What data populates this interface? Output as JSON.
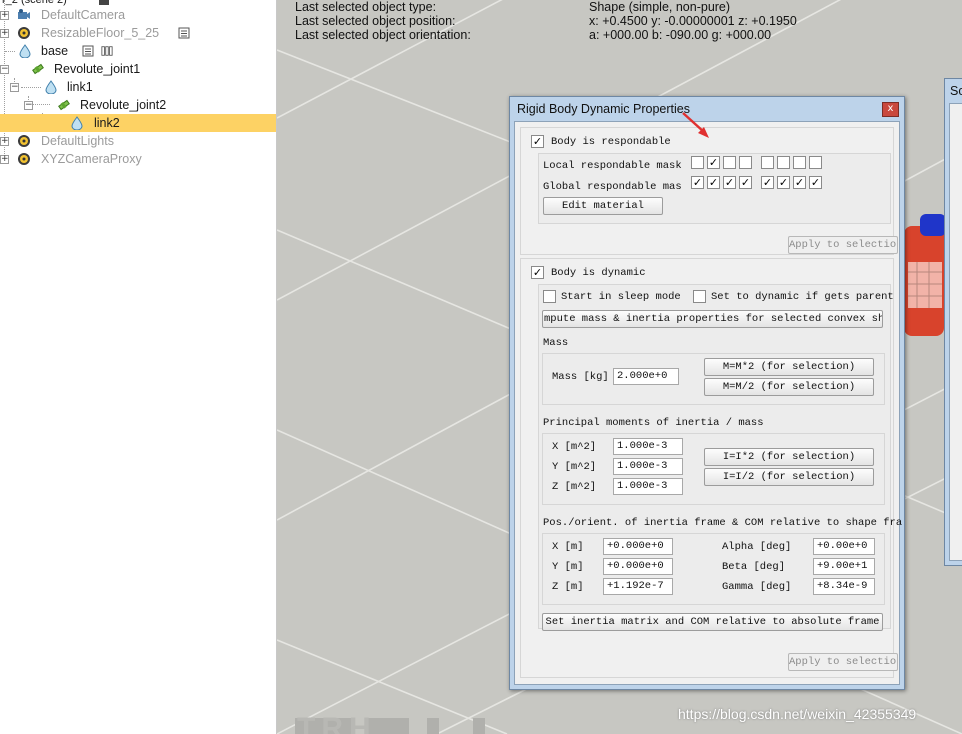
{
  "tree": {
    "items": [
      {
        "label": "r_2 (scene 2)",
        "dim": false
      },
      {
        "label": "DefaultCamera",
        "dim": true
      },
      {
        "label": "ResizableFloor_5_25",
        "dim": true
      },
      {
        "label": "base",
        "dim": false
      },
      {
        "label": "Revolute_joint1",
        "dim": false
      },
      {
        "label": "link1",
        "dim": false
      },
      {
        "label": "Revolute_joint2",
        "dim": false
      },
      {
        "label": "link2",
        "dim": false,
        "selected": true
      },
      {
        "label": "DefaultLights",
        "dim": true
      },
      {
        "label": "XYZCameraProxy",
        "dim": true
      }
    ]
  },
  "viewport": {
    "info": [
      {
        "label": "Last selected object type:",
        "value": "Shape (simple, non-pure)"
      },
      {
        "label": "Last selected object position:",
        "value": "x: +0.4500    y: -0.00000001    z: +0.1950"
      },
      {
        "label": "Last selected object orientation:",
        "value": "a: +000.00    b: -090.00    g: +000.00"
      }
    ],
    "watermark": "https://blog.csdn.net/weixin_42355349",
    "bottom_text": "TRH"
  },
  "dialog": {
    "title": "Rigid Body Dynamic Properties",
    "close_glyph": "x",
    "body_respondable": {
      "label": "Body is respondable",
      "checked": true
    },
    "local_mask": {
      "label": "Local respondable mask",
      "bits": [
        false,
        true,
        false,
        false,
        false,
        false,
        false,
        false
      ]
    },
    "global_mask": {
      "label": "Global respondable mas",
      "bits": [
        true,
        true,
        true,
        true,
        true,
        true,
        true,
        true
      ]
    },
    "edit_material": "Edit material",
    "apply_top": "Apply to selection",
    "body_dynamic": {
      "label": "Body is dynamic",
      "checked": true
    },
    "sleep_mode": {
      "label": "Start in sleep mode",
      "checked": false
    },
    "set_dynamic": {
      "label": "Set to dynamic if gets parent",
      "checked": false
    },
    "compute_btn": "mpute mass & inertia properties for selected convex shap",
    "mass_title": "Mass",
    "mass_label": "Mass [kg]",
    "mass_value": "2.000e+0",
    "mass_x2": "M=M*2  (for selection)",
    "mass_half": "M=M/2  (for selection)",
    "inertia_title": "Principal moments of inertia / mass",
    "inertia": [
      {
        "label": "X [m^2]",
        "value": "1.000e-3"
      },
      {
        "label": "Y [m^2]",
        "value": "1.000e-3"
      },
      {
        "label": "Z [m^2]",
        "value": "1.000e-3"
      }
    ],
    "inertia_x2": "I=I*2  (for selection)",
    "inertia_half": "I=I/2  (for selection)",
    "frame_title": "Pos./orient. of inertia frame & COM relative to shape fra",
    "pos": [
      {
        "label": "X [m]",
        "value": "+0.000e+0"
      },
      {
        "label": "Y [m]",
        "value": "+0.000e+0"
      },
      {
        "label": "Z [m]",
        "value": "+1.192e-7"
      }
    ],
    "orient": [
      {
        "label": "Alpha [deg]",
        "value": "+0.00e+0"
      },
      {
        "label": "Beta [deg]",
        "value": "+9.00e+1"
      },
      {
        "label": "Gamma [deg]",
        "value": "+8.34e-9"
      }
    ],
    "set_inertia_btn": "Set inertia matrix and COM relative to absolute frame",
    "apply_bottom": "Apply to selection"
  },
  "dialog2": {
    "title": "Sc"
  },
  "colors": {
    "selected_row": "#fdd264",
    "arrow": "#e03030",
    "dialog_frame": "#bdd3ea"
  }
}
